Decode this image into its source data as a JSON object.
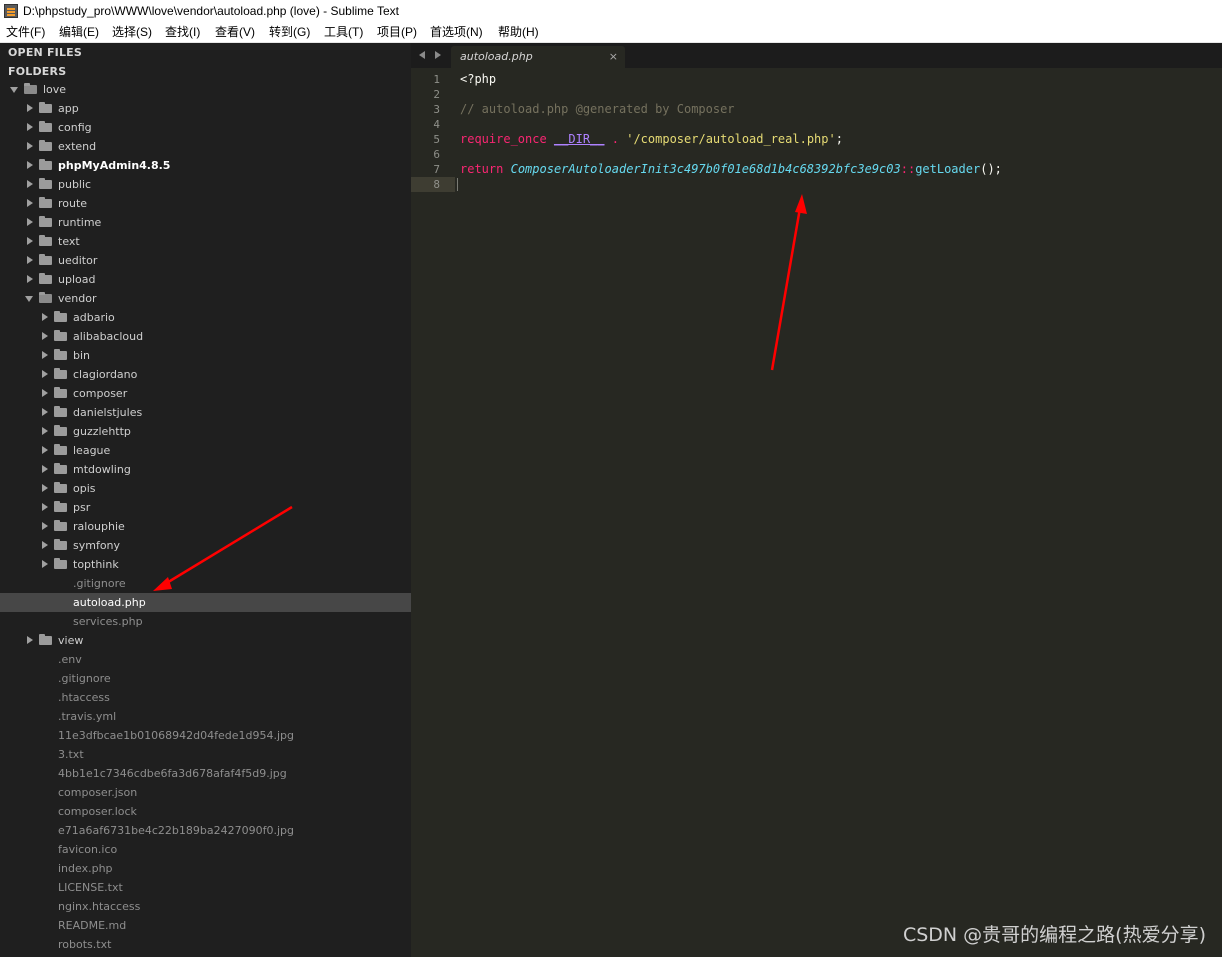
{
  "window": {
    "title": "D:\\phpstudy_pro\\WWW\\love\\vendor\\autoload.php (love) - Sublime Text"
  },
  "menu": [
    "文件(F)",
    "编辑(E)",
    "选择(S)",
    "查找(I)",
    "查看(V)",
    "转到(G)",
    "工具(T)",
    "项目(P)",
    "首选项(N)",
    "帮助(H)"
  ],
  "sidebar": {
    "open_files_label": "OPEN FILES",
    "folders_label": "FOLDERS",
    "tree": [
      {
        "label": "love",
        "type": "folder",
        "expanded": true,
        "depth": 0
      },
      {
        "label": "app",
        "type": "folder",
        "depth": 1
      },
      {
        "label": "config",
        "type": "folder",
        "depth": 1
      },
      {
        "label": "extend",
        "type": "folder",
        "depth": 1
      },
      {
        "label": "phpMyAdmin4.8.5",
        "type": "folder",
        "depth": 1,
        "bold": true
      },
      {
        "label": "public",
        "type": "folder",
        "depth": 1
      },
      {
        "label": "route",
        "type": "folder",
        "depth": 1
      },
      {
        "label": "runtime",
        "type": "folder",
        "depth": 1
      },
      {
        "label": "text",
        "type": "folder",
        "depth": 1
      },
      {
        "label": "ueditor",
        "type": "folder",
        "depth": 1
      },
      {
        "label": "upload",
        "type": "folder",
        "depth": 1
      },
      {
        "label": "vendor",
        "type": "folder",
        "expanded": true,
        "depth": 1
      },
      {
        "label": "adbario",
        "type": "folder",
        "depth": 2
      },
      {
        "label": "alibabacloud",
        "type": "folder",
        "depth": 2
      },
      {
        "label": "bin",
        "type": "folder",
        "depth": 2
      },
      {
        "label": "clagiordano",
        "type": "folder",
        "depth": 2
      },
      {
        "label": "composer",
        "type": "folder",
        "depth": 2
      },
      {
        "label": "danielstjules",
        "type": "folder",
        "depth": 2
      },
      {
        "label": "guzzlehttp",
        "type": "folder",
        "depth": 2
      },
      {
        "label": "league",
        "type": "folder",
        "depth": 2
      },
      {
        "label": "mtdowling",
        "type": "folder",
        "depth": 2
      },
      {
        "label": "opis",
        "type": "folder",
        "depth": 2
      },
      {
        "label": "psr",
        "type": "folder",
        "depth": 2
      },
      {
        "label": "ralouphie",
        "type": "folder",
        "depth": 2
      },
      {
        "label": "symfony",
        "type": "folder",
        "depth": 2
      },
      {
        "label": "topthink",
        "type": "folder",
        "depth": 2
      },
      {
        "label": ".gitignore",
        "type": "file",
        "depth": 2
      },
      {
        "label": "autoload.php",
        "type": "file",
        "depth": 2,
        "selected": true
      },
      {
        "label": "services.php",
        "type": "file",
        "depth": 2
      },
      {
        "label": "view",
        "type": "folder",
        "depth": 1
      },
      {
        "label": ".env",
        "type": "file",
        "depth": 1
      },
      {
        "label": ".gitignore",
        "type": "file",
        "depth": 1
      },
      {
        "label": ".htaccess",
        "type": "file",
        "depth": 1
      },
      {
        "label": ".travis.yml",
        "type": "file",
        "depth": 1
      },
      {
        "label": "11e3dfbcae1b01068942d04fede1d954.jpg",
        "type": "file",
        "depth": 1
      },
      {
        "label": "3.txt",
        "type": "file",
        "depth": 1
      },
      {
        "label": "4bb1e1c7346cdbe6fa3d678afaf4f5d9.jpg",
        "type": "file",
        "depth": 1
      },
      {
        "label": "composer.json",
        "type": "file",
        "depth": 1
      },
      {
        "label": "composer.lock",
        "type": "file",
        "depth": 1
      },
      {
        "label": "e71a6af6731be4c22b189ba2427090f0.jpg",
        "type": "file",
        "depth": 1
      },
      {
        "label": "favicon.ico",
        "type": "file",
        "depth": 1
      },
      {
        "label": "index.php",
        "type": "file",
        "depth": 1
      },
      {
        "label": "LICENSE.txt",
        "type": "file",
        "depth": 1
      },
      {
        "label": "nginx.htaccess",
        "type": "file",
        "depth": 1
      },
      {
        "label": "README.md",
        "type": "file",
        "depth": 1
      },
      {
        "label": "robots.txt",
        "type": "file",
        "depth": 1
      }
    ]
  },
  "tabs": [
    {
      "label": "autoload.php",
      "close": "×"
    }
  ],
  "editor": {
    "lines": [
      {
        "n": "1",
        "tokens": [
          {
            "t": "<?php",
            "c": ""
          }
        ]
      },
      {
        "n": "2",
        "tokens": []
      },
      {
        "n": "3",
        "tokens": [
          {
            "t": "// autoload.php @generated by Composer",
            "c": "c-comment"
          }
        ]
      },
      {
        "n": "4",
        "tokens": []
      },
      {
        "n": "5",
        "tokens": [
          {
            "t": "require_once",
            "c": "c-kw"
          },
          {
            "t": " ",
            "c": ""
          },
          {
            "t": "__DIR__",
            "c": "c-const"
          },
          {
            "t": " ",
            "c": ""
          },
          {
            "t": ".",
            "c": "c-op"
          },
          {
            "t": " ",
            "c": ""
          },
          {
            "t": "'/composer/autoload_real.php'",
            "c": "c-str"
          },
          {
            "t": ";",
            "c": ""
          }
        ]
      },
      {
        "n": "6",
        "tokens": []
      },
      {
        "n": "7",
        "tokens": [
          {
            "t": "return",
            "c": "c-kw"
          },
          {
            "t": " ",
            "c": ""
          },
          {
            "t": "ComposerAutoloaderInit3c497b0f01e68d1b4c68392bfc3e9c03",
            "c": "c-cls"
          },
          {
            "t": "::",
            "c": "c-op"
          },
          {
            "t": "getLoader",
            "c": "c-fn"
          },
          {
            "t": "();",
            "c": ""
          }
        ]
      },
      {
        "n": "8",
        "tokens": [],
        "current": true
      }
    ]
  },
  "watermark": "CSDN @贵哥的编程之路(热爱分享)",
  "colors": {
    "annotation_arrow": "#ff0000",
    "sidebar_bg": "#1f1f1f",
    "editor_bg": "#272822"
  }
}
